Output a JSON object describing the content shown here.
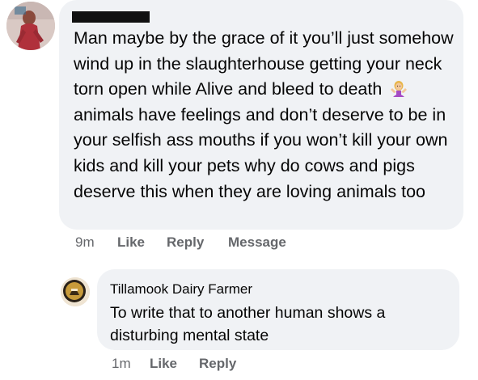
{
  "comment": {
    "text_before_emoji": "Man maybe by the grace of it you’ll just somehow wind up in the slaughterhouse getting your neck torn open while Alive and bleed to death",
    "emoji": "woman-shrugging-emoji",
    "text_after_emoji": "animals have feelings and don’t deserve to be in your selfish ass mouths if you won’t kill your own kids and kill your pets why do cows and pigs deserve this when they are loving animals too",
    "timestamp": "9m",
    "like_label": "Like",
    "reply_label": "Reply",
    "message_label": "Message"
  },
  "reply": {
    "author": "Tillamook Dairy Farmer",
    "text": "To write that to another human shows a disturbing mental state",
    "timestamp": "1m",
    "like_label": "Like",
    "reply_label": "Reply"
  },
  "colors": {
    "bubble": "#f0f2f5",
    "text": "#050505",
    "meta": "#65676b",
    "redaction": "#111111"
  }
}
